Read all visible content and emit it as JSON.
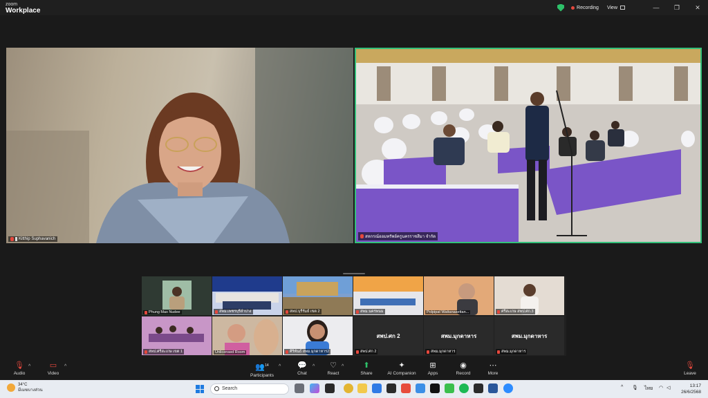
{
  "app": {
    "brand_small": "zoom",
    "brand_large": "Workplace"
  },
  "titlebar": {
    "recording_label": "Recording",
    "view_label": "View",
    "minimize": "—",
    "restore": "❐",
    "close": "✕"
  },
  "colors": {
    "accent_green": "#33c17a",
    "recording_red": "#e5483d",
    "mic_muted_red": "#e5483d"
  },
  "main_videos": [
    {
      "name": "Kitthip Suphavanich",
      "muted": true,
      "pinned": true
    },
    {
      "name": "สหกรณ์ออมทรัพย์ครูนครราชสีมา จำกัด",
      "muted": true,
      "active_speaker": true
    }
  ],
  "gallery": [
    {
      "label": "Phung Max Nudee",
      "kind": "video"
    },
    {
      "label": "สพม.เพชรบุรีลำปาง",
      "kind": "video"
    },
    {
      "label": "สพป.บุรีรัมย์ เขต 2",
      "kind": "video"
    },
    {
      "label": "สพม.นครพนม",
      "kind": "video"
    },
    {
      "label": "Polpipat Wattanasettan...",
      "kind": "video"
    },
    {
      "label": "ศรีสะเกษ สพป.ศก.3",
      "kind": "video"
    },
    {
      "label": "สพป.ศรีสะเกษ เขต 1",
      "kind": "video"
    },
    {
      "label": "Unlicensed Room",
      "kind": "video"
    },
    {
      "label": "ศิริพันธ์ สพม.มุกดาหาร2",
      "kind": "video"
    },
    {
      "label": "สพป.ศก 2",
      "kind": "name",
      "big": "สพป.ศก 2"
    },
    {
      "label": "สพม.มุกดาหาร",
      "kind": "name",
      "big": "สพม.มุกดาหาร"
    },
    {
      "label": "สพม.มุกดาหาร",
      "kind": "name",
      "big": "สพม.มุกดาหาร"
    }
  ],
  "toolbar": {
    "audio": "Audio",
    "video": "Video",
    "participants": "Participants",
    "participants_count": "14",
    "chat": "Chat",
    "react": "React",
    "share": "Share",
    "ai_companion": "AI Companion",
    "apps": "Apps",
    "record": "Record",
    "more": "More",
    "leave": "Leave"
  },
  "taskbar": {
    "temperature": "34°C",
    "weather_text": "มีเมฆบางส่วน",
    "search_placeholder": "Search",
    "language": "ไทย",
    "time": "13:17",
    "date": "26/6/2568",
    "notification_count": "1"
  }
}
